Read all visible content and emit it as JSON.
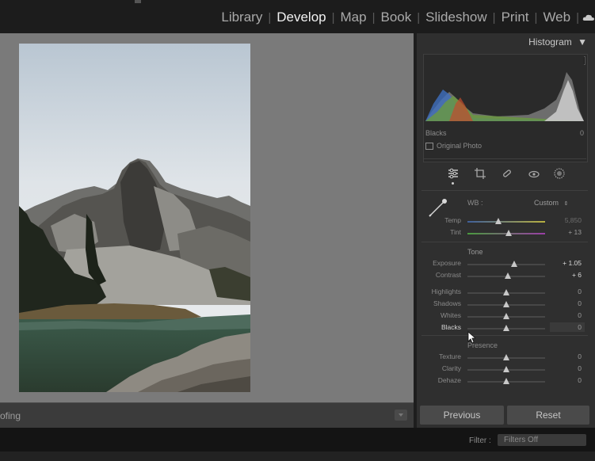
{
  "modules": {
    "items": [
      "Library",
      "Develop",
      "Map",
      "Book",
      "Slideshow",
      "Print",
      "Web"
    ],
    "active": "Develop"
  },
  "left": {
    "soft_proofing_label": "ofing"
  },
  "histogram": {
    "title": "Histogram",
    "readout_label": "Blacks",
    "readout_value": "0",
    "original_photo_label": "Original Photo"
  },
  "basic": {
    "wb_label": "WB :",
    "wb_value": "Custom",
    "temp": {
      "label": "Temp",
      "value": "5,850",
      "position": 0.4
    },
    "tint": {
      "label": "Tint",
      "value": "+ 13",
      "position": 0.53
    },
    "tone_title": "Tone",
    "exposure": {
      "label": "Exposure",
      "value": "+ 1.05",
      "position": 0.6
    },
    "contrast": {
      "label": "Contrast",
      "value": "+ 6",
      "position": 0.52
    },
    "highlights": {
      "label": "Highlights",
      "value": "0",
      "position": 0.5
    },
    "shadows": {
      "label": "Shadows",
      "value": "0",
      "position": 0.5
    },
    "whites": {
      "label": "Whites",
      "value": "0",
      "position": 0.5
    },
    "blacks": {
      "label": "Blacks",
      "value": "0",
      "position": 0.5
    },
    "presence_title": "Presence",
    "texture": {
      "label": "Texture",
      "value": "0",
      "position": 0.5
    },
    "clarity": {
      "label": "Clarity",
      "value": "0",
      "position": 0.5
    },
    "dehaze": {
      "label": "Dehaze",
      "value": "0",
      "position": 0.5
    }
  },
  "buttons": {
    "previous": "Previous",
    "reset": "Reset"
  },
  "filter": {
    "label": "Filter :",
    "value": "Filters Off"
  },
  "colors": {
    "accent": "#f2f2f2",
    "panel": "#2f2f2f",
    "viewer": "#7a7a7a"
  }
}
